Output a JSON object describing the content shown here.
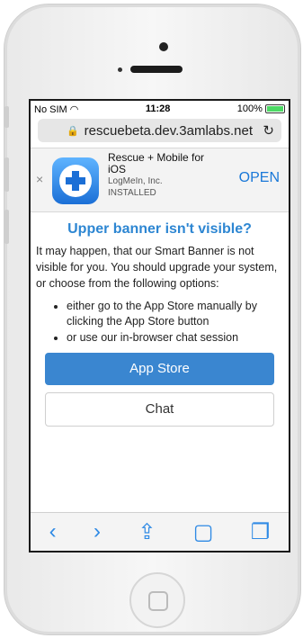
{
  "status_bar": {
    "carrier": "No SIM",
    "wifi": "wifi-icon",
    "time": "11:28",
    "battery": "100%"
  },
  "browser": {
    "url": "rescuebeta.dev.3amlabs.net",
    "lock_icon": "lock-icon",
    "reload_icon": "reload-icon"
  },
  "smart_banner": {
    "close": "×",
    "app_name_line1": "Rescue + Mobile for",
    "app_name_line2": "iOS",
    "publisher": "LogMeIn, Inc.",
    "status": "INSTALLED",
    "open_label": "OPEN"
  },
  "page": {
    "heading": "Upper banner isn't visible?",
    "paragraph": "It may happen, that our Smart Banner is not visible for you. You should upgrade your system, or choose from the following options:",
    "options": [
      "either go to the App Store manually by clicking the App Store button",
      "or use our in-browser chat session"
    ],
    "app_store_label": "App Store",
    "chat_label": "Chat"
  },
  "toolbar": {
    "back": "‹",
    "forward": "›",
    "share": "⇪",
    "bookmarks": "▢",
    "tabs": "❐"
  }
}
